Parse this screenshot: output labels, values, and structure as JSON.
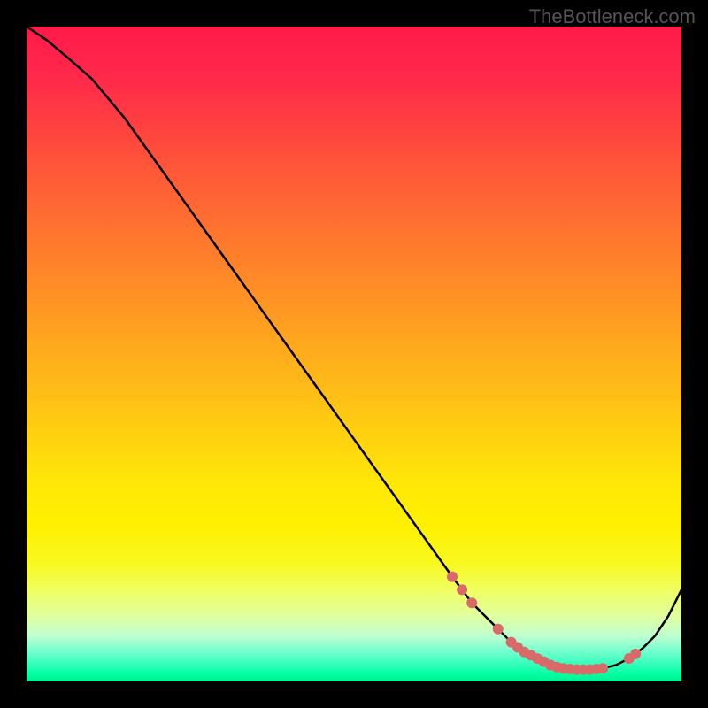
{
  "watermark": "TheBottleneck.com",
  "colors": {
    "gradient_top": "#ff1a4a",
    "gradient_bottom": "#00f090",
    "curve": "#000000",
    "markers": "#d96a6a",
    "background": "#000000"
  },
  "chart_data": {
    "type": "line",
    "title": "",
    "xlabel": "",
    "ylabel": "",
    "xlim": [
      0,
      100
    ],
    "ylim": [
      0,
      100
    ],
    "curve": {
      "x": [
        0,
        3,
        6,
        10,
        15,
        20,
        25,
        30,
        35,
        40,
        45,
        50,
        55,
        60,
        65,
        68,
        70,
        72,
        74,
        76,
        78,
        80,
        82,
        84,
        86,
        88,
        90,
        92,
        94,
        96,
        98,
        100
      ],
      "y": [
        100,
        98,
        95.5,
        92,
        86,
        79,
        72,
        65,
        58,
        51,
        44,
        37,
        30,
        23,
        16,
        12,
        10,
        8,
        6,
        4.5,
        3.5,
        2.5,
        2,
        1.8,
        1.8,
        2,
        2.5,
        3.5,
        5,
        7,
        10,
        14
      ]
    },
    "markers": [
      {
        "x": 65,
        "y": 16
      },
      {
        "x": 66.5,
        "y": 14
      },
      {
        "x": 68,
        "y": 12
      },
      {
        "x": 72,
        "y": 8
      },
      {
        "x": 74,
        "y": 6
      },
      {
        "x": 75,
        "y": 5.2
      },
      {
        "x": 76,
        "y": 4.5
      },
      {
        "x": 77,
        "y": 4
      },
      {
        "x": 78,
        "y": 3.5
      },
      {
        "x": 79,
        "y": 3
      },
      {
        "x": 80,
        "y": 2.5
      },
      {
        "x": 81,
        "y": 2.2
      },
      {
        "x": 82,
        "y": 2
      },
      {
        "x": 83,
        "y": 1.9
      },
      {
        "x": 84,
        "y": 1.8
      },
      {
        "x": 85,
        "y": 1.8
      },
      {
        "x": 86,
        "y": 1.8
      },
      {
        "x": 87,
        "y": 1.9
      },
      {
        "x": 88,
        "y": 2
      },
      {
        "x": 92,
        "y": 3.5
      },
      {
        "x": 93,
        "y": 4.2
      }
    ]
  }
}
